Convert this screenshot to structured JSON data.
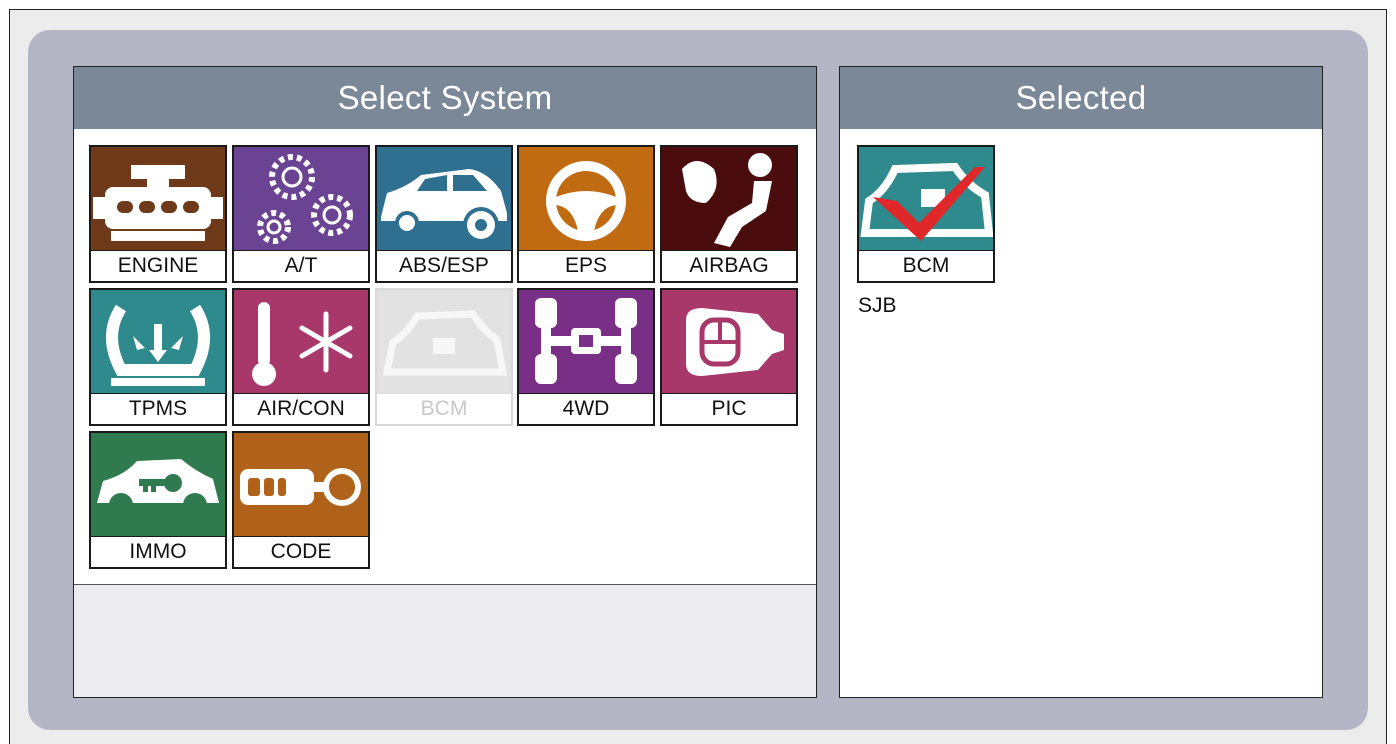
{
  "left_panel": {
    "title": "Select System"
  },
  "right_panel": {
    "title": "Selected",
    "caption": "SJB"
  },
  "systems": [
    {
      "label": "ENGINE",
      "color": "#6e3a1a",
      "icon": "engine-icon"
    },
    {
      "label": "A/T",
      "color": "#6a4493",
      "icon": "gears-icon"
    },
    {
      "label": "ABS/ESP",
      "color": "#2f6f8f",
      "icon": "car-brake-icon"
    },
    {
      "label": "EPS",
      "color": "#c06a12",
      "icon": "steering-wheel-icon"
    },
    {
      "label": "AIRBAG",
      "color": "#4a0c0c",
      "icon": "airbag-icon"
    },
    {
      "label": "TPMS",
      "color": "#2e8a8c",
      "icon": "tire-pressure-icon"
    },
    {
      "label": "AIR/CON",
      "color": "#a8376a",
      "icon": "aircon-icon"
    },
    {
      "label": "BCM",
      "color": "#e2e2e2",
      "icon": "body-control-icon",
      "disabled": true
    },
    {
      "label": "4WD",
      "color": "#7a2f86",
      "icon": "drivetrain-icon"
    },
    {
      "label": "PIC",
      "color": "#a8376a",
      "icon": "smart-key-icon"
    },
    {
      "label": "IMMO",
      "color": "#2f7a4e",
      "icon": "immobilizer-icon"
    },
    {
      "label": "CODE",
      "color": "#b0621a",
      "icon": "key-fob-icon"
    }
  ],
  "selected": [
    {
      "label": "BCM",
      "color": "#2e8a8c",
      "icon": "body-control-checked-icon"
    }
  ]
}
